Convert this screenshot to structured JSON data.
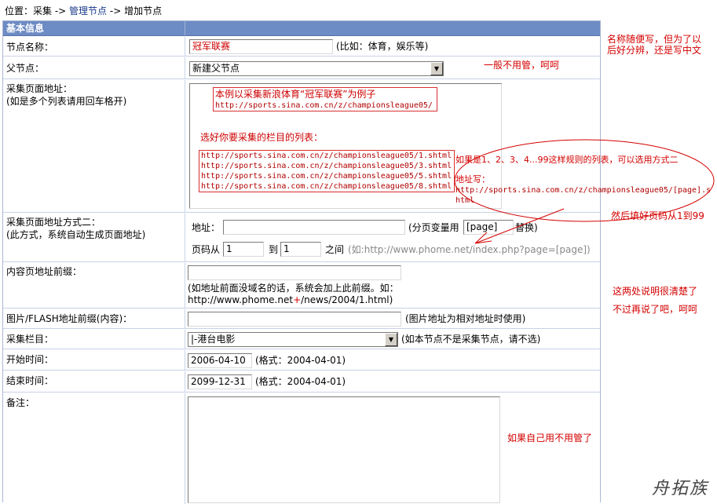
{
  "breadcrumb": {
    "prefix": "位置：采集 ->",
    "link": "管理节点",
    "suffix": "-> 增加节点"
  },
  "header": {
    "title": "基本信息"
  },
  "rows": {
    "node_name": {
      "label": "节点名称：",
      "value": "冠军联赛",
      "hint": "(比如：体育，娱乐等)"
    },
    "parent": {
      "label": "父节点：",
      "selected": "新建父节点"
    },
    "collect_url": {
      "label": "采集页面地址：",
      "label_sub": "(如是多个列表请用回车格开)",
      "example_title": "本例以采集新浪体育“冠军联赛”为例子",
      "example_url": "http://sports.sina.com.cn/z/championsleague05/",
      "choose_text": "选好你要采集的栏目的列表：",
      "list": [
        "http://sports.sina.com.cn/z/championsleague05/1.shtml",
        "http://sports.sina.com.cn/z/championsleague05/3.shtml",
        "http://sports.sina.com.cn/z/championsleague05/5.shtml",
        "http://sports.sina.com.cn/z/championsleague05/8.shtml"
      ]
    },
    "mode2": {
      "label": "采集页面地址方式二：",
      "label_sub": "(此方式，系统自动生成页面地址)",
      "addr_label": "地址：",
      "addr_value": "",
      "var_label": "(分页变量用",
      "var_value": "[page]",
      "var_suffix": "替换)",
      "page_from": "页码从",
      "from_value": "1",
      "to_label": "到",
      "to_value": "1",
      "between_label": "之间",
      "example": "(如:http://www.phome.net/index.php?page=[page])"
    },
    "content_prefix": {
      "label": "内容页地址前缀：",
      "hint_line1": "(如地址前面没域名的话，系统会加上此前缀。如：",
      "hint_line2_a": "http://www.phome.net",
      "hint_line2_b": "+",
      "hint_line2_c": "/news/2004/1.html)"
    },
    "image_prefix": {
      "label": "图片/FLASH地址前缀(内容)：",
      "hint": "(图片地址为相对地址时使用)"
    },
    "column": {
      "label": "采集栏目：",
      "selected": "|-港台电影",
      "hint": "(如本节点不是采集节点，请不选)"
    },
    "start_time": {
      "label": "开始时间：",
      "value": "2006-04-10",
      "hint": "(格式：2004-04-01)"
    },
    "end_time": {
      "label": "结束时间：",
      "value": "2099-12-31",
      "hint": "(格式：2004-04-01)"
    },
    "remark": {
      "label": "备注："
    }
  },
  "annotations": {
    "name_line1": "名称随便写，但为了以",
    "name_line2": "后好分辨，还是写中文",
    "parent": "一般不用管，呵呵",
    "oval_line1": "如果是1、2、3、4...99这样规则的列表，可以选用方式二",
    "oval_line2": "地址写：",
    "oval_url1": "http://sports.sina.com.cn/z/championsleague05/[page].s",
    "oval_url2": "html",
    "page_range": "然后填好页码从1到99",
    "two_line1": "这两处说明很清楚了",
    "two_line2": "不过再说了吧，呵呵",
    "remark": "如果自己用不用管了"
  },
  "watermark": "舟拓族",
  "colors": {
    "header_bg": "#6d8bc4",
    "annotation_red": "#d40000",
    "link_blue": "#1a3a8a"
  }
}
